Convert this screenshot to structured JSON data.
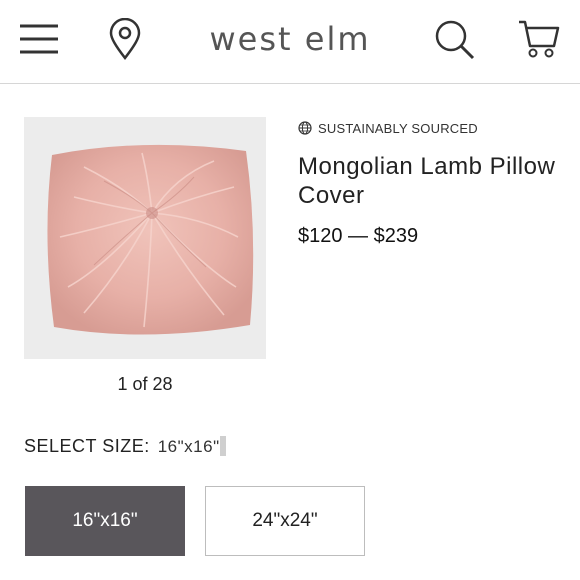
{
  "header": {
    "logo": "west elm",
    "icons": [
      "menu-icon",
      "location-pin-icon",
      "search-icon",
      "cart-icon"
    ]
  },
  "product": {
    "badge": "SUSTAINABLY SOURCED",
    "title": "Mongolian Lamb Pillow Cover",
    "price": "$120 — $239",
    "image_counter": "1 of 28",
    "image_color": "#e9b7ae"
  },
  "size": {
    "label": "SELECT SIZE:",
    "selected": "16\"x16\"",
    "options": [
      "16\"x16\"",
      "24\"x24\""
    ]
  },
  "colors": {
    "selected_bg": "#59565b",
    "text": "#222222",
    "divider": "#d6d6d6"
  }
}
